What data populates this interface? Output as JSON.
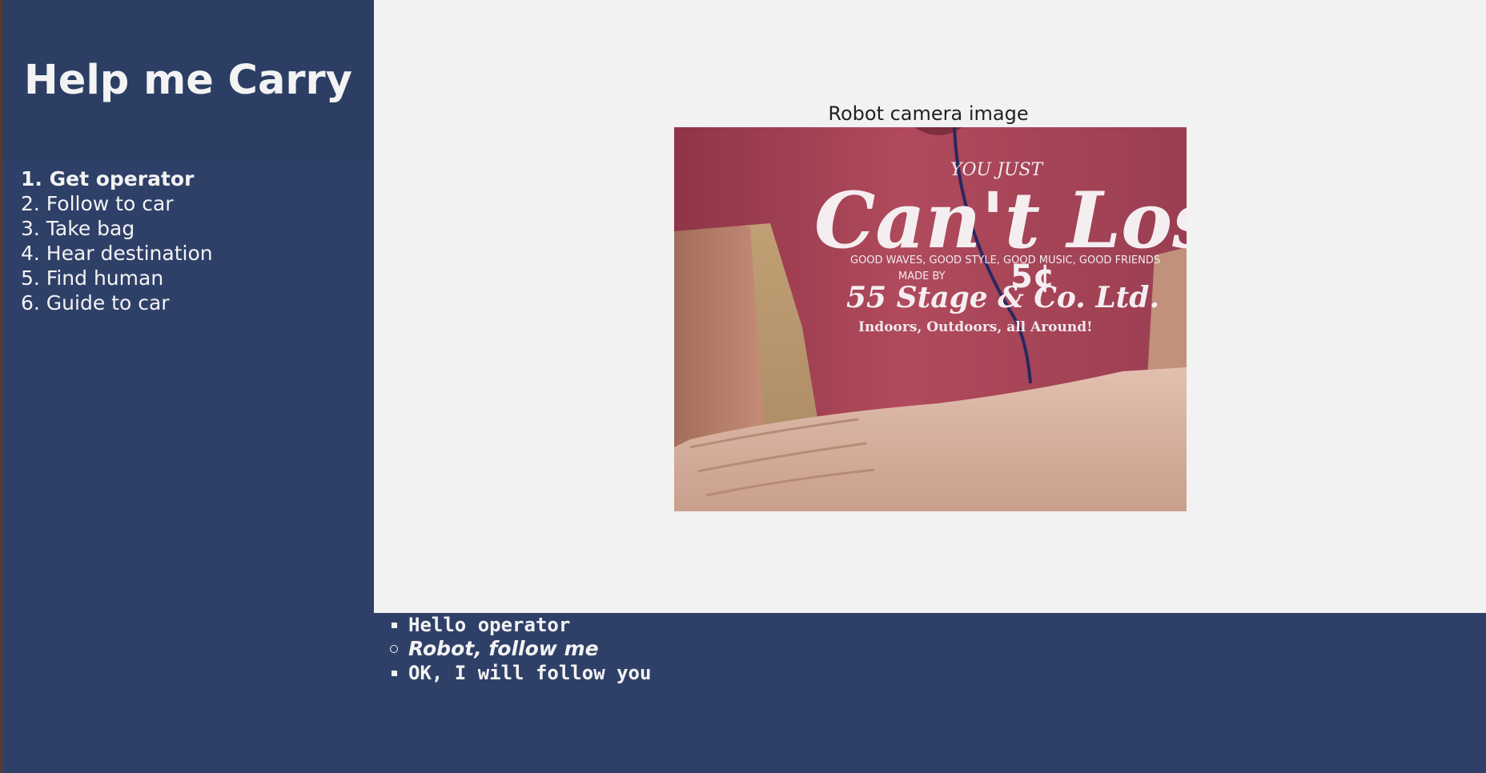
{
  "app": {
    "title": "Help me Carry"
  },
  "steps": [
    {
      "label": "1. Get operator",
      "active": true
    },
    {
      "label": "2. Follow to car",
      "active": false
    },
    {
      "label": "3. Take bag",
      "active": false
    },
    {
      "label": "4. Hear destination",
      "active": false
    },
    {
      "label": "5. Find human",
      "active": false
    },
    {
      "label": "6. Guide to car",
      "active": false
    }
  ],
  "camera": {
    "caption": "Robot camera image",
    "shirt_print": {
      "line1": "YOU JUST",
      "line2": "Can't Lose",
      "line3": "GOOD WAVES, GOOD STYLE, GOOD MUSIC, GOOD FRIENDS",
      "price": "5¢",
      "made_by": "MADE BY",
      "maker": "55 Stage & Co. Ltd.",
      "tagline": "Indoors, Outdoors, all Around!"
    }
  },
  "conversation": [
    {
      "speaker": "robot",
      "text": "Hello operator"
    },
    {
      "speaker": "human",
      "text": "Robot, follow me"
    },
    {
      "speaker": "robot",
      "text": "OK, I will follow you"
    }
  ],
  "colors": {
    "sidebar": "#2f4068",
    "sidebar_header": "#2c3e64",
    "main_background": "#f2f2f2",
    "text_light": "#f3f3f3",
    "shirt": "#b04a5c"
  }
}
